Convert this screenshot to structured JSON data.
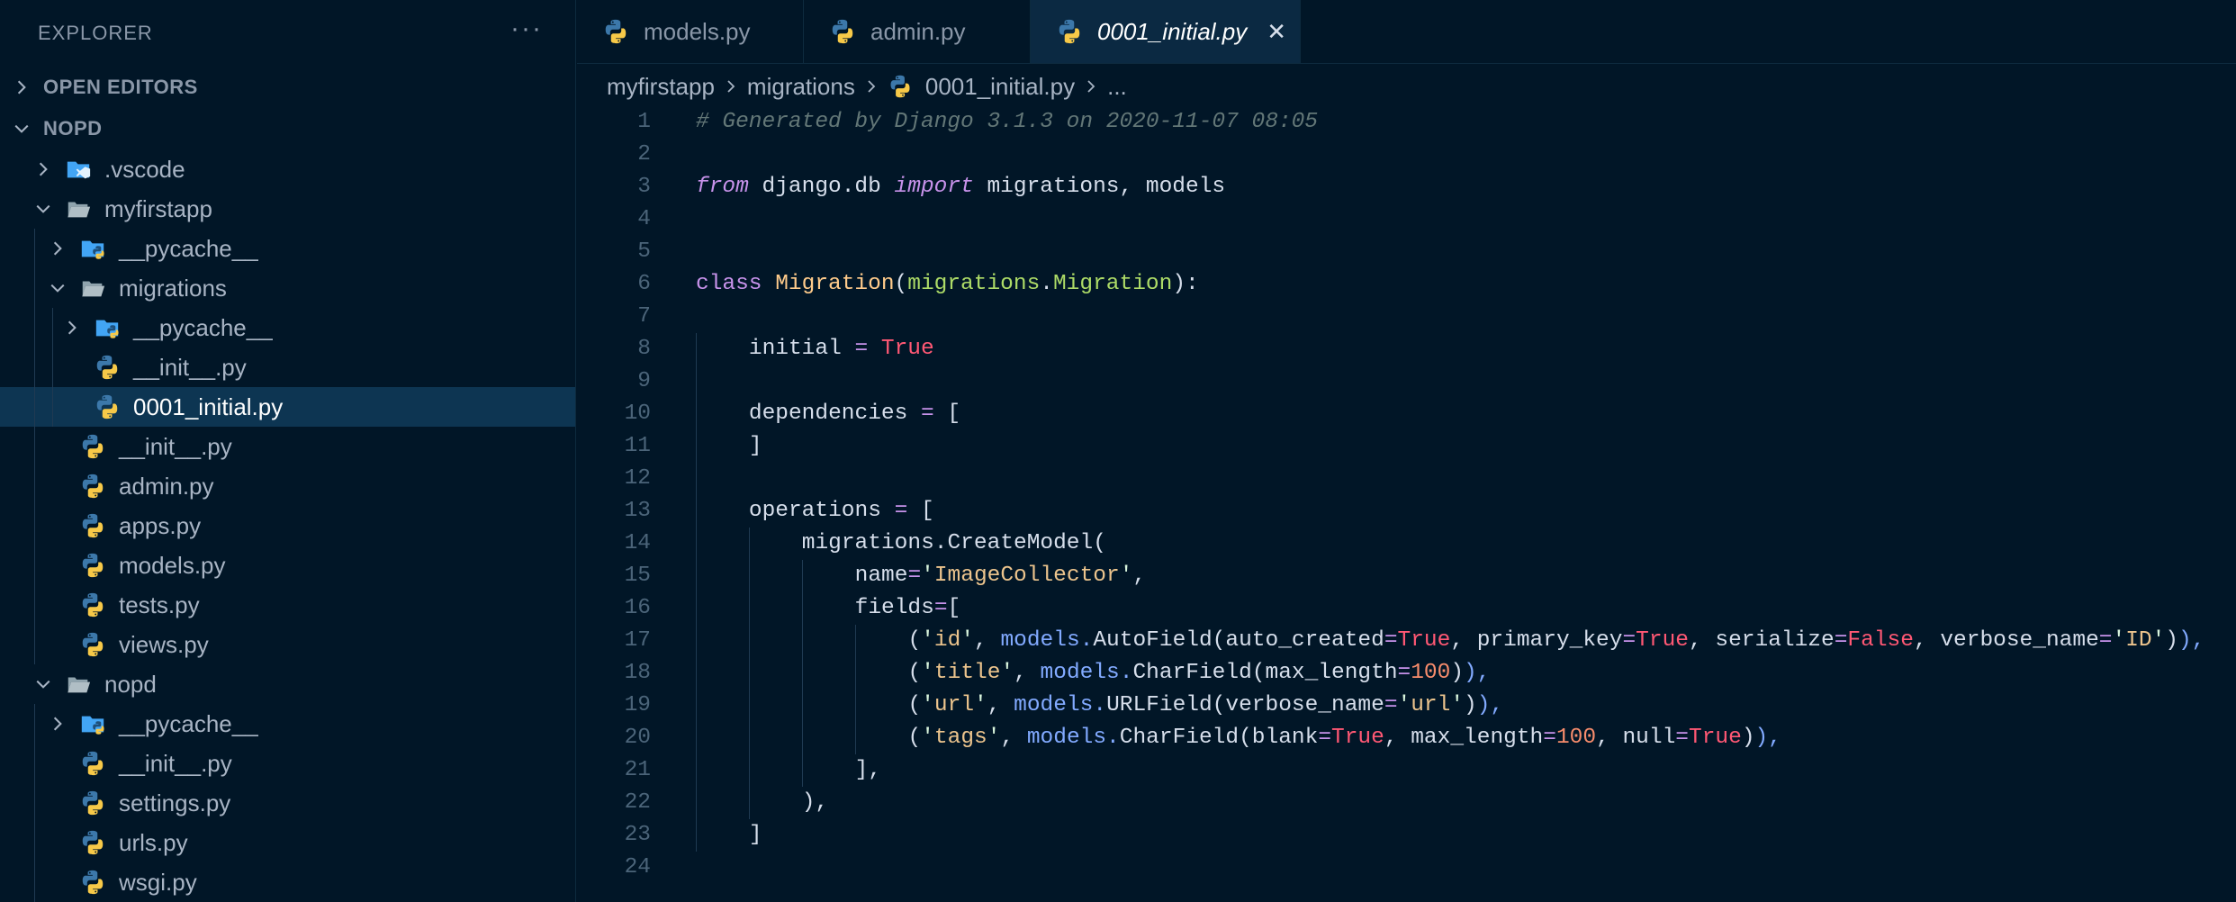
{
  "sidebar": {
    "title": "EXPLORER",
    "more": "···",
    "sections": {
      "open_editors": "OPEN EDITORS",
      "project": "NOPD"
    },
    "tree": [
      {
        "label": ".vscode",
        "icon": "vscode-folder-icon",
        "depth": 1,
        "chevron": "right"
      },
      {
        "label": "myfirstapp",
        "icon": "folder-open-icon",
        "depth": 1,
        "chevron": "down"
      },
      {
        "label": "__pycache__",
        "icon": "pycache-folder-icon",
        "depth": 2,
        "chevron": "right"
      },
      {
        "label": "migrations",
        "icon": "folder-open-icon",
        "depth": 2,
        "chevron": "down"
      },
      {
        "label": "__pycache__",
        "icon": "pycache-folder-icon",
        "depth": 3,
        "chevron": "right"
      },
      {
        "label": "__init__.py",
        "icon": "python-icon",
        "depth": 3,
        "chevron": "none"
      },
      {
        "label": "0001_initial.py",
        "icon": "python-icon",
        "depth": 3,
        "chevron": "none",
        "selected": true
      },
      {
        "label": "__init__.py",
        "icon": "python-icon",
        "depth": 2,
        "chevron": "none"
      },
      {
        "label": "admin.py",
        "icon": "python-icon",
        "depth": 2,
        "chevron": "none"
      },
      {
        "label": "apps.py",
        "icon": "python-icon",
        "depth": 2,
        "chevron": "none"
      },
      {
        "label": "models.py",
        "icon": "python-icon",
        "depth": 2,
        "chevron": "none"
      },
      {
        "label": "tests.py",
        "icon": "python-icon",
        "depth": 2,
        "chevron": "none"
      },
      {
        "label": "views.py",
        "icon": "python-icon",
        "depth": 2,
        "chevron": "none"
      },
      {
        "label": "nopd",
        "icon": "folder-open-icon",
        "depth": 1,
        "chevron": "down"
      },
      {
        "label": "__pycache__",
        "icon": "pycache-folder-icon",
        "depth": 2,
        "chevron": "right"
      },
      {
        "label": "__init__.py",
        "icon": "python-icon",
        "depth": 2,
        "chevron": "none"
      },
      {
        "label": "settings.py",
        "icon": "python-icon",
        "depth": 2,
        "chevron": "none"
      },
      {
        "label": "urls.py",
        "icon": "python-icon",
        "depth": 2,
        "chevron": "none"
      },
      {
        "label": "wsgi.py",
        "icon": "python-icon",
        "depth": 2,
        "chevron": "none"
      }
    ]
  },
  "tabs": [
    {
      "label": "models.py",
      "icon": "python-icon",
      "active": false
    },
    {
      "label": "admin.py",
      "icon": "python-icon",
      "active": false
    },
    {
      "label": "0001_initial.py",
      "icon": "python-icon",
      "active": true,
      "close": "✕"
    }
  ],
  "breadcrumb": {
    "items": [
      "myfirstapp",
      "migrations",
      "0001_initial.py",
      "..."
    ]
  },
  "editor": {
    "lines": [
      {
        "n": "1",
        "indent": 0,
        "tokens": [
          [
            "comment",
            "# Generated by Django 3.1.3 on 2020-11-07 08:05"
          ]
        ]
      },
      {
        "n": "2",
        "indent": 0,
        "tokens": []
      },
      {
        "n": "3",
        "indent": 0,
        "tokens": [
          [
            "kw",
            "from"
          ],
          [
            "plain",
            " django.db "
          ],
          [
            "kw",
            "import"
          ],
          [
            "plain",
            " migrations, models"
          ]
        ]
      },
      {
        "n": "4",
        "indent": 0,
        "tokens": []
      },
      {
        "n": "5",
        "indent": 0,
        "tokens": []
      },
      {
        "n": "6",
        "indent": 0,
        "tokens": [
          [
            "kw2",
            "class"
          ],
          [
            "plain",
            " "
          ],
          [
            "cls",
            "Migration"
          ],
          [
            "plain",
            "("
          ],
          [
            "attr",
            "migrations"
          ],
          [
            "plain",
            "."
          ],
          [
            "attr",
            "Migration"
          ],
          [
            "plain",
            "):"
          ]
        ]
      },
      {
        "n": "7",
        "indent": 0,
        "tokens": []
      },
      {
        "n": "8",
        "indent": 1,
        "tokens": [
          [
            "plain",
            "initial "
          ],
          [
            "op",
            "="
          ],
          [
            "plain",
            " "
          ],
          [
            "bool",
            "True"
          ]
        ]
      },
      {
        "n": "9",
        "indent": 1,
        "tokens": []
      },
      {
        "n": "10",
        "indent": 1,
        "tokens": [
          [
            "plain",
            "dependencies "
          ],
          [
            "op",
            "="
          ],
          [
            "plain",
            " ["
          ]
        ]
      },
      {
        "n": "11",
        "indent": 1,
        "tokens": [
          [
            "plain",
            "]"
          ]
        ]
      },
      {
        "n": "12",
        "indent": 1,
        "tokens": []
      },
      {
        "n": "13",
        "indent": 1,
        "tokens": [
          [
            "plain",
            "operations "
          ],
          [
            "op",
            "="
          ],
          [
            "plain",
            " ["
          ]
        ]
      },
      {
        "n": "14",
        "indent": 2,
        "tokens": [
          [
            "plain",
            "migrations.CreateModel("
          ]
        ]
      },
      {
        "n": "15",
        "indent": 3,
        "tokens": [
          [
            "plain",
            "name"
          ],
          [
            "op",
            "="
          ],
          [
            "q",
            "'"
          ],
          [
            "str",
            "ImageCollector"
          ],
          [
            "q",
            "'"
          ],
          [
            "plain",
            ","
          ]
        ]
      },
      {
        "n": "16",
        "indent": 3,
        "tokens": [
          [
            "plain",
            "fields"
          ],
          [
            "op",
            "="
          ],
          [
            "plain",
            "["
          ]
        ]
      },
      {
        "n": "17",
        "indent": 4,
        "tokens": [
          [
            "plain",
            "("
          ],
          [
            "q",
            "'"
          ],
          [
            "str",
            "id"
          ],
          [
            "q",
            "'"
          ],
          [
            "plain",
            ", "
          ],
          [
            "fn",
            "models."
          ],
          [
            "plain",
            "AutoField(auto_created"
          ],
          [
            "op",
            "="
          ],
          [
            "bool",
            "True"
          ],
          [
            "plain",
            ", primary_key"
          ],
          [
            "op",
            "="
          ],
          [
            "bool",
            "True"
          ],
          [
            "plain",
            ", serialize"
          ],
          [
            "op",
            "="
          ],
          [
            "bool",
            "False"
          ],
          [
            "plain",
            ", verbose_name"
          ],
          [
            "op",
            "="
          ],
          [
            "q",
            "'"
          ],
          [
            "str",
            "ID"
          ],
          [
            "q",
            "'"
          ],
          [
            "plain",
            ")"
          ],
          [
            "fn",
            "),"
          ]
        ]
      },
      {
        "n": "18",
        "indent": 4,
        "tokens": [
          [
            "plain",
            "("
          ],
          [
            "q",
            "'"
          ],
          [
            "str",
            "title"
          ],
          [
            "q",
            "'"
          ],
          [
            "plain",
            ", "
          ],
          [
            "fn",
            "models."
          ],
          [
            "plain",
            "CharField(max_length"
          ],
          [
            "op",
            "="
          ],
          [
            "num",
            "100"
          ],
          [
            "plain",
            ")"
          ],
          [
            "fn",
            "),"
          ]
        ]
      },
      {
        "n": "19",
        "indent": 4,
        "tokens": [
          [
            "plain",
            "("
          ],
          [
            "q",
            "'"
          ],
          [
            "str",
            "url"
          ],
          [
            "q",
            "'"
          ],
          [
            "plain",
            ", "
          ],
          [
            "fn",
            "models."
          ],
          [
            "plain",
            "URLField(verbose_name"
          ],
          [
            "op",
            "="
          ],
          [
            "q",
            "'"
          ],
          [
            "str",
            "url"
          ],
          [
            "q",
            "'"
          ],
          [
            "plain",
            ")"
          ],
          [
            "fn",
            "),"
          ]
        ]
      },
      {
        "n": "20",
        "indent": 4,
        "tokens": [
          [
            "plain",
            "("
          ],
          [
            "q",
            "'"
          ],
          [
            "str",
            "tags"
          ],
          [
            "q",
            "'"
          ],
          [
            "plain",
            ", "
          ],
          [
            "fn",
            "models."
          ],
          [
            "plain",
            "CharField(blank"
          ],
          [
            "op",
            "="
          ],
          [
            "bool",
            "True"
          ],
          [
            "plain",
            ", max_length"
          ],
          [
            "op",
            "="
          ],
          [
            "num",
            "100"
          ],
          [
            "plain",
            ", null"
          ],
          [
            "op",
            "="
          ],
          [
            "bool",
            "True"
          ],
          [
            "plain",
            ")"
          ],
          [
            "fn",
            "),"
          ]
        ]
      },
      {
        "n": "21",
        "indent": 3,
        "tokens": [
          [
            "plain",
            "],"
          ]
        ]
      },
      {
        "n": "22",
        "indent": 2,
        "tokens": [
          [
            "plain",
            "),"
          ]
        ]
      },
      {
        "n": "23",
        "indent": 1,
        "tokens": [
          [
            "plain",
            "]"
          ]
        ]
      },
      {
        "n": "24",
        "indent": 0,
        "tokens": []
      }
    ]
  },
  "colors": {
    "background": "#011627",
    "selection": "#0d3552",
    "python_blue": "#3c78aa",
    "python_yellow": "#f7c948"
  }
}
